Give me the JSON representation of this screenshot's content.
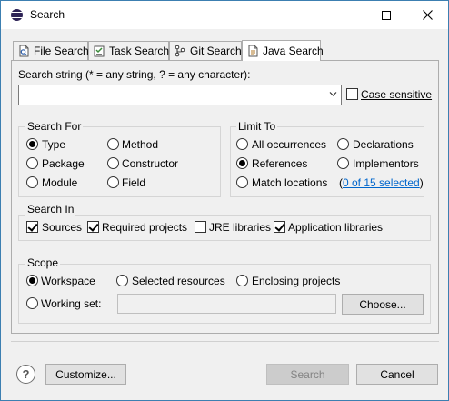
{
  "window": {
    "title": "Search"
  },
  "titlebar": {
    "minimize": "—",
    "maximize": "☐",
    "close": "✕"
  },
  "tabs": [
    {
      "label": "File Search",
      "icon": "file-search-icon"
    },
    {
      "label": "Task Search",
      "icon": "task-search-icon"
    },
    {
      "label": "Git Search",
      "icon": "git-search-icon"
    },
    {
      "label": "Java Search",
      "icon": "java-search-icon"
    }
  ],
  "search_string": {
    "label": "Search string (* = any string, ? = any character):",
    "value": "",
    "case_sensitive_label": "Case sensitive",
    "case_sensitive": false
  },
  "search_for": {
    "title": "Search For",
    "options": [
      {
        "label": "Type",
        "checked": true
      },
      {
        "label": "Method",
        "checked": false
      },
      {
        "label": "Package",
        "checked": false
      },
      {
        "label": "Constructor",
        "checked": false
      },
      {
        "label": "Module",
        "checked": false
      },
      {
        "label": "Field",
        "checked": false
      }
    ]
  },
  "limit_to": {
    "title": "Limit To",
    "options": [
      {
        "label": "All occurrences",
        "checked": false
      },
      {
        "label": "Declarations",
        "checked": false
      },
      {
        "label": "References",
        "checked": true
      },
      {
        "label": "Implementors",
        "checked": false
      },
      {
        "label": "Match locations",
        "checked": false
      }
    ],
    "match_link": "0 of 15 selected",
    "paren_open": "(",
    "paren_close": ")"
  },
  "search_in": {
    "title": "Search In",
    "options": [
      {
        "label": "Sources",
        "checked": true
      },
      {
        "label": "Required projects",
        "checked": true
      },
      {
        "label": "JRE libraries",
        "checked": false
      },
      {
        "label": "Application libraries",
        "checked": true
      }
    ]
  },
  "scope": {
    "title": "Scope",
    "options": [
      {
        "label": "Workspace",
        "checked": true
      },
      {
        "label": "Selected resources",
        "checked": false
      },
      {
        "label": "Enclosing projects",
        "checked": false
      },
      {
        "label": "Working set:",
        "checked": false
      }
    ],
    "working_set_value": "",
    "choose_label": "Choose..."
  },
  "footer": {
    "help_label": "?",
    "customize_label": "Customize...",
    "search_label": "Search",
    "cancel_label": "Cancel"
  },
  "colors": {
    "link": "#0066cc",
    "border": "#3c7fb1"
  }
}
